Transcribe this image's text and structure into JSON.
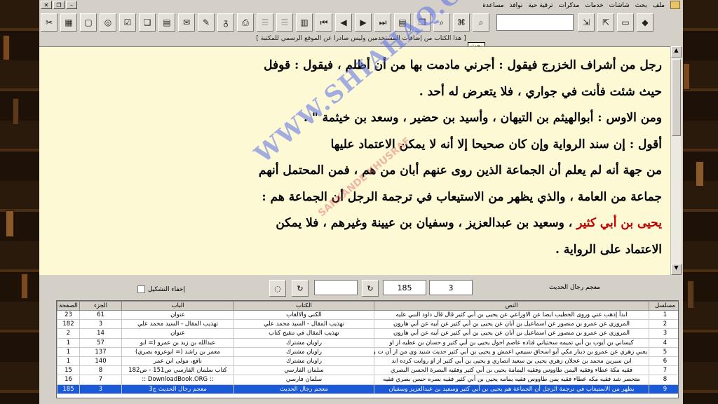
{
  "menu": [
    "ملف",
    "بحث",
    "شاشات",
    "خدمات",
    "مذكرات",
    "ترقية حية",
    "نوافذ",
    "مساعدة"
  ],
  "notice": "[ هذا الكتاب من إضافات المستخدمين وليس صادرا عن الموقع الرسمي للمكتبة ]",
  "tooltip": "بحث",
  "reader_lines": [
    "رجل من أشراف الخزرج فيقول : أجرني مادمت بها من أن أظلم ، فيقول : قوفل",
    "حيث شئت فأنت في جواري ، فلا يتعرض له أحد .",
    "ومن الاوس : أبوالهيثم بن التيهان ، وأسيد بن حضير ، وسعد بن خيثمة \" .",
    "أقول : إن سند الرواية وإن كان صحيحا إلا أنه لا يمكن الاعتماد عليها",
    "من جهة أنه لم يعلم أن الجماعة الذين روى عنهم أبان من هم ، فمن المحتمل أنهم",
    "جماعة من العامة ، والذي يظهر من الاستيعاب في ترجمة الرجل أن الجماعة هم :",
    "، وسعيد بن عبدالعزيز ، وسفيان بن عيينة وغيرهم ، فلا يمكن",
    "الاعتماد على الرواية ."
  ],
  "reader_highlight": "يحيى بن أبي كثير",
  "watermark": "WWW.SHIAHAQ.COM",
  "watermark2": "SARKANDE KHUSRAF",
  "controls": {
    "book_label": "معجم رجال الحديث",
    "volume": "3",
    "page": "185",
    "hide_diacritics": "إخفاء التشكيل"
  },
  "table": {
    "headers": [
      "مسلسل",
      "النص",
      "الكتاب",
      "الباب",
      "الجزء",
      "الصفحة"
    ],
    "rows": [
      [
        "1",
        "ابدأ إذهب عني وروى الخطيب ايضا عن الاوزاعي عن يحيى بن أبي كثير قال قال داود النبي عليه",
        "الكنى والالقاب",
        "عنوان",
        "61",
        "23"
      ],
      [
        "2",
        "المروزي عن عمرو بن منصور عن اسماعيل بن أبان عن يحيى بن أبي كثير عن أبيه عن أبي هارون",
        "تهذيب المقال - السيد محمد علي",
        "تهذيب المقال - السيد محمد علي",
        "3",
        "182"
      ],
      [
        "3",
        "المروزي عن عمرو بن منصور عن اسماعيل بن أبان عن يحيى بن أبي كثير عن أبيه عن أبي هارون",
        "تهذيب المقال في تنقيح كتاب",
        "عنوان",
        "14",
        "2"
      ],
      [
        "4",
        "كيساني بن أيوب بن أبي تميمه سختياني قتاده عاصم احول يحيى بن أبي كثير و حسان بن عطيه از او",
        "راويان مشترك",
        "عبدالله بن زيد بن عمرو (= ابو",
        "57",
        "1"
      ],
      [
        "5",
        "يعني زهري عن عمرو بن دينار مكي أبو اسحاق سبيعي اعمش و يحيى بن أبي كثير حديث شنيد وي من از آن ت و",
        "راويان مشترك",
        "معمر بن راشد (= ابوعروه بصري)",
        "137",
        "1"
      ],
      [
        "6",
        "ابن سيرين محمد بن عجلان زهري يحيى بن سعيد انصاري و يحيى بن أبي كثير از او روايت كرده اند",
        "راويان مشترك",
        "نافع، مولى ابن عمر",
        "140",
        "1"
      ],
      [
        "7",
        "فقيه مكة عطاء وفقيه اليمن طاووس وفقيه اليمامة يحيى بن أبي كثير وفقيه البصرة الحسن البصري",
        "سلمان الفارسي",
        "كتاب سلمان الفارسي ص151 - ص182",
        "8",
        "15"
      ],
      [
        "8",
        "متحصر شد فقيه مكه عطاء فقيه يمن طاووس فقيه يمامه يحيى بن أبي كثير فقيه بصره حسن بصري فقيه",
        "سلمان فارسي",
        ":: DownloadBook.ORG ::",
        "7",
        "16"
      ],
      [
        "9",
        "يظهر من الاستيعاب في ترجمة الرجل أن الجماعة هم يحيى بن أبي كثير وسعيد بن عبدالعزيز وسفيان",
        "معجم رجال الحديث",
        "معجم رجال الحديث ج3",
        "3",
        "185"
      ]
    ]
  }
}
